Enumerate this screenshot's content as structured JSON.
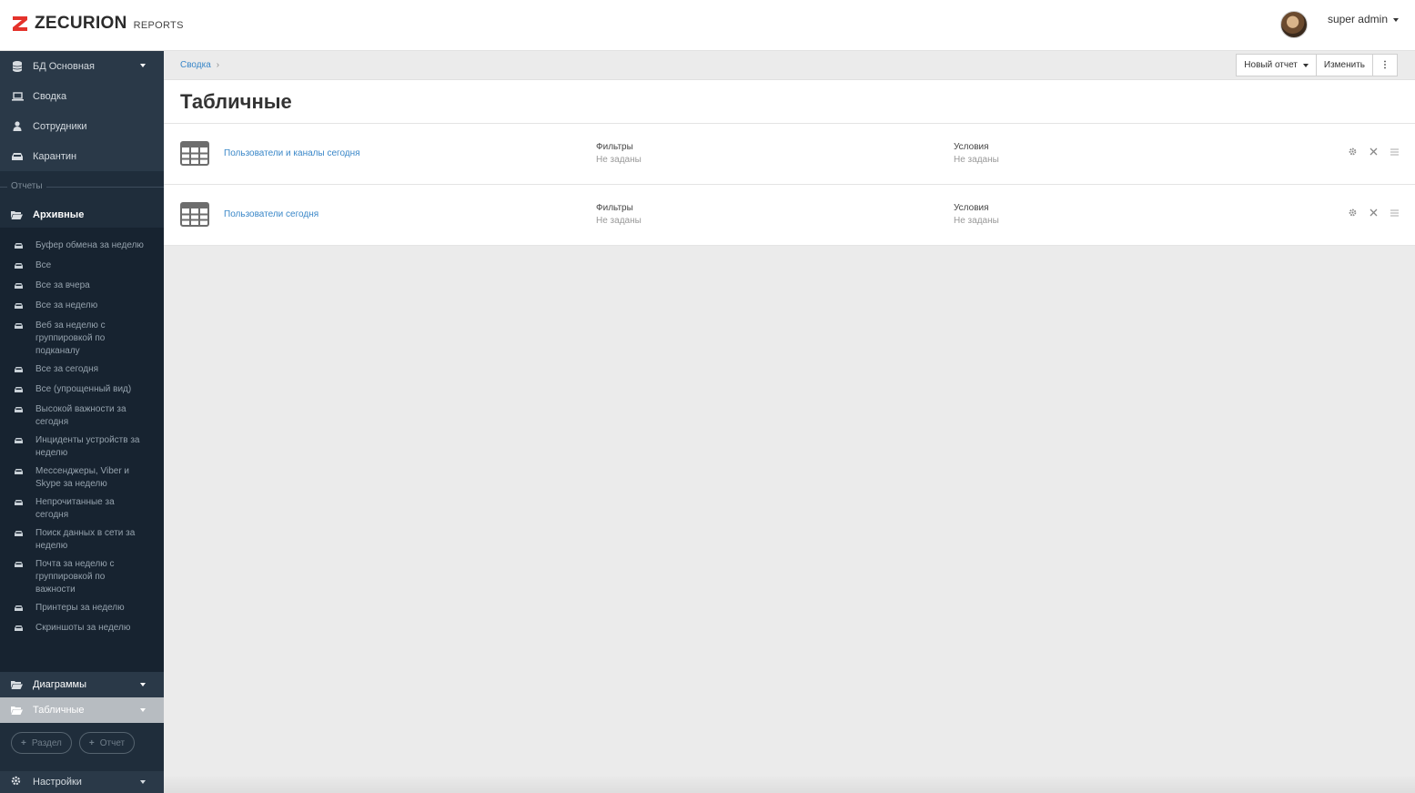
{
  "header": {
    "brand": "ZECURION",
    "brand_sub": "REPORTS",
    "user_name": "super admin"
  },
  "sidebar": {
    "db_label": "БД Основная",
    "nav": [
      {
        "label": "Сводка",
        "icon": "laptop-icon"
      },
      {
        "label": "Сотрудники",
        "icon": "user-icon"
      },
      {
        "label": "Карантин",
        "icon": "inbox-icon"
      }
    ],
    "section_label": "Отчеты",
    "archive_folder": "Архивные",
    "archive_items": [
      "Буфер обмена за неделю",
      "Все",
      "Все за вчера",
      "Все за неделю",
      "Веб за неделю с группировкой по подканалу",
      "Все за сегодня",
      "Все (упрощенный вид)",
      "Высокой важности за сегодня",
      "Инциденты устройств за неделю",
      "Мессенджеры, Viber и Skype за неделю",
      "Непрочитанные за сегодня",
      "Поиск данных в сети за неделю",
      "Почта за неделю с группировкой по важности",
      "Принтеры за неделю",
      "Скриншоты за неделю"
    ],
    "diagrams_folder": "Диаграммы",
    "tables_folder": "Табличные",
    "add_section": "Раздел",
    "add_report": "Отчет",
    "settings": "Настройки"
  },
  "main": {
    "breadcrumb": "Сводка",
    "new_report_button": "Новый отчет",
    "edit_button": "Изменить",
    "kebab": "⋮",
    "title": "Табличные",
    "reports": [
      {
        "name": "Пользователи и каналы сегодня",
        "filters_label": "Фильтры",
        "filters_value": "Не заданы",
        "conditions_label": "Условия",
        "conditions_value": "Не заданы"
      },
      {
        "name": "Пользователи сегодня",
        "filters_label": "Фильтры",
        "filters_value": "Не заданы",
        "conditions_label": "Условия",
        "conditions_value": "Не заданы"
      }
    ]
  },
  "colors": {
    "sidebar_bg": "#1f2d3b",
    "link": "#3a87c8",
    "brand_red": "#e4322b"
  }
}
